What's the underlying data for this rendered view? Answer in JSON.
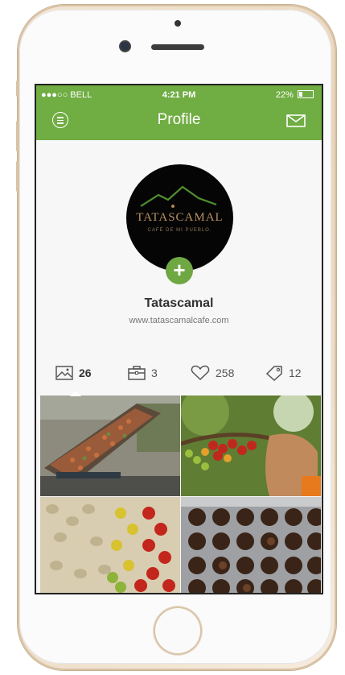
{
  "status_bar": {
    "carrier": "●●●○○ BELL",
    "time": "4:21 PM",
    "battery": "22%"
  },
  "header": {
    "title": "Profile",
    "menu_icon": "menu-icon",
    "mail_icon": "mail-icon"
  },
  "profile": {
    "logo_brand": "TATASCAMAL",
    "logo_tagline": "CAFÉ DE MI PUEBLO.",
    "add_label": "+",
    "name": "Tatascamal",
    "website": "www.tatascamalcafe.com"
  },
  "stats": [
    {
      "icon": "image-icon",
      "value": "26"
    },
    {
      "icon": "briefcase-icon",
      "value": "3"
    },
    {
      "icon": "heart-icon",
      "value": "258"
    },
    {
      "icon": "tag-icon",
      "value": "12"
    }
  ],
  "photos": [
    {
      "subject": "coffee-drying-tray"
    },
    {
      "subject": "coffee-cherries-branch"
    },
    {
      "subject": "coffee-beans-varieties"
    },
    {
      "subject": "roasted-coffee-cups"
    }
  ],
  "colors": {
    "accent": "#70ad43",
    "phone_gold": "#e9d6bd"
  }
}
